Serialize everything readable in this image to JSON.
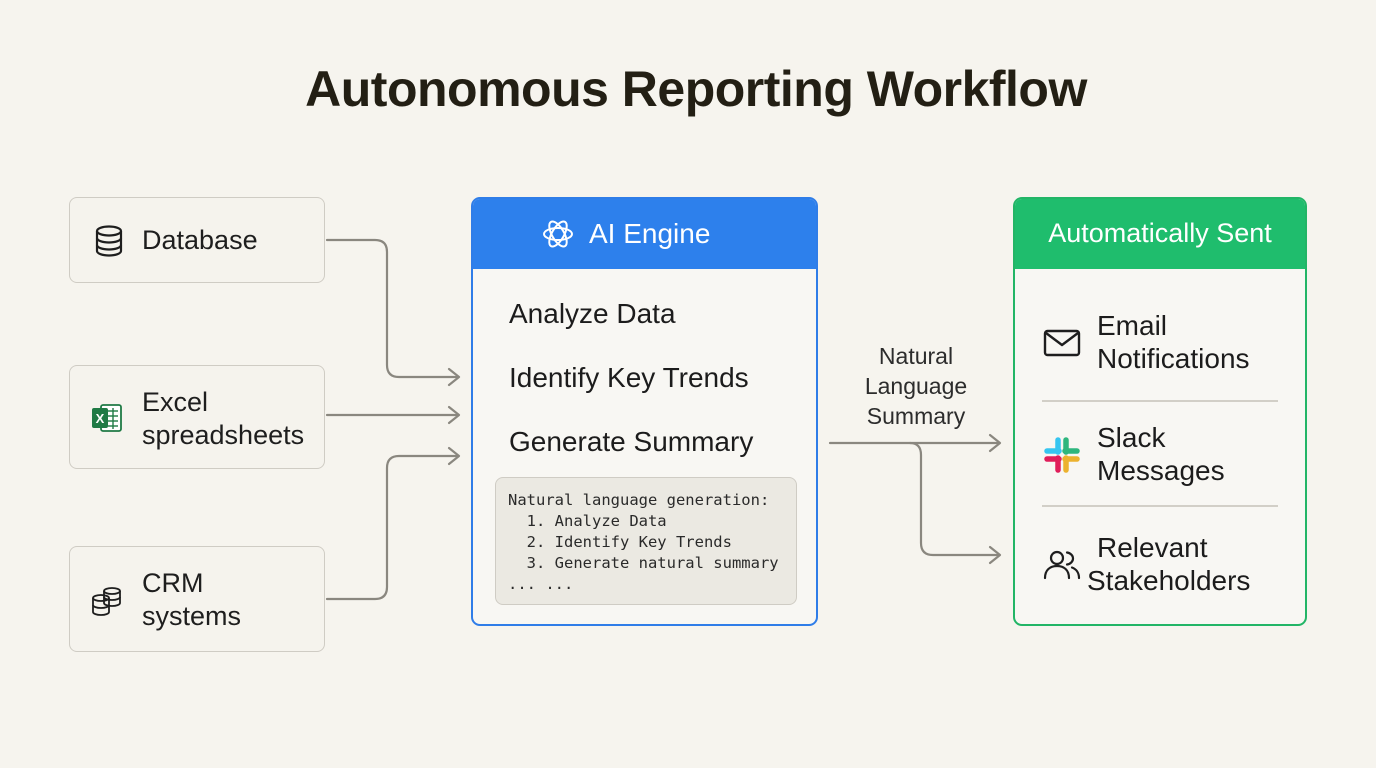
{
  "title": "Autonomous Reporting Workflow",
  "sources": [
    {
      "icon": "database-icon",
      "lines": [
        "Database"
      ]
    },
    {
      "icon": "excel-icon",
      "lines": [
        "Excel",
        "spreadsheets"
      ]
    },
    {
      "icon": "crm-icon",
      "lines": [
        "CRM",
        "systems"
      ]
    }
  ],
  "engine": {
    "header": "AI Engine",
    "icon": "ai-engine-icon",
    "accent": "#2d80ec",
    "steps": [
      "Analyze Data",
      "Identify Key Trends",
      "Generate Summary"
    ],
    "code_lines": [
      "Natural language generation:",
      "  1. Analyze Data",
      "  2. Identify Key Trends",
      "  3. Generate natural summary",
      "... ..."
    ]
  },
  "connector_label": [
    "Natural",
    "Language",
    "Summary"
  ],
  "sent": {
    "header": "Automatically Sent",
    "accent": "#1fbd6d",
    "destinations": [
      {
        "icon": "mail-icon",
        "lines": [
          "Email",
          "Notifications"
        ]
      },
      {
        "icon": "slack-icon",
        "lines": [
          "Slack",
          "Messages"
        ]
      },
      {
        "icon": "users-icon",
        "lines": [
          "Relevant",
          "Stakeholders"
        ]
      }
    ]
  }
}
